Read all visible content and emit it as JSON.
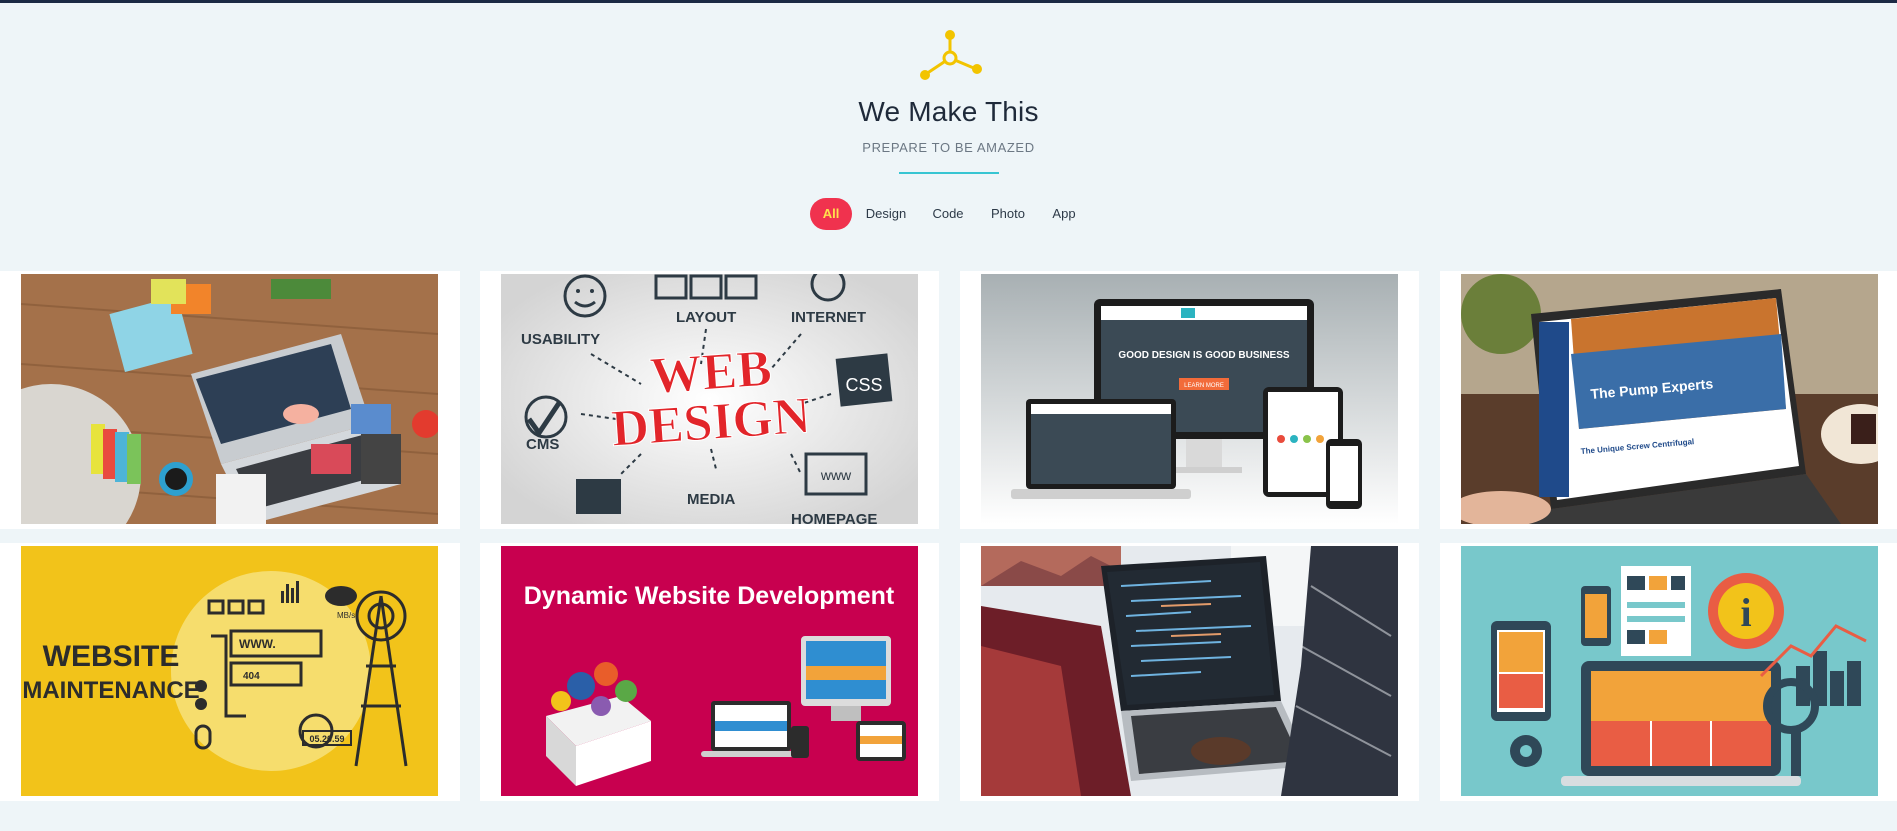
{
  "header": {
    "logo_icon": "network-node-icon",
    "title": "We Make This",
    "subtitle": "PREPARE TO BE AMAZED",
    "accent_color": "#37c5d2",
    "logo_color": "#f2c400"
  },
  "filters": {
    "items": [
      {
        "label": "All",
        "active": true
      },
      {
        "label": "Design",
        "active": false
      },
      {
        "label": "Code",
        "active": false
      },
      {
        "label": "Photo",
        "active": false
      },
      {
        "label": "App",
        "active": false
      }
    ],
    "active_bg": "#f0324e",
    "active_text": "#ffe14d"
  },
  "portfolio": {
    "items": [
      {
        "name": "workspace-laptop-photo",
        "caption": ""
      },
      {
        "name": "web-design-words",
        "words": {
          "main1": "WEB",
          "main2": "DESIGN",
          "usability": "USABILITY",
          "layout": "LAYOUT",
          "internet": "INTERNET",
          "css": "CSS",
          "cms": "CMS",
          "media": "MEDIA",
          "homepage": "HOMEPAGE",
          "www": "www"
        }
      },
      {
        "name": "responsive-devices",
        "words": {
          "headline": "GOOD DESIGN IS GOOD BUSINESS",
          "button": "LEARN MORE"
        }
      },
      {
        "name": "pump-experts-laptop",
        "words": {
          "headline": "The Pump Experts",
          "sub": "The Unique Screw Centrifugal"
        }
      },
      {
        "name": "website-maintenance",
        "words": {
          "line1": "WEBSITE",
          "line2": "MAINTENANCE",
          "www": "WWW.",
          "code": "404",
          "date": "05.20.59",
          "speed": "MB/s"
        }
      },
      {
        "name": "dynamic-website-development",
        "words": {
          "headline": "Dynamic Website Development"
        }
      },
      {
        "name": "coding-laptop-photo"
      },
      {
        "name": "flat-infographic-devices"
      }
    ]
  }
}
